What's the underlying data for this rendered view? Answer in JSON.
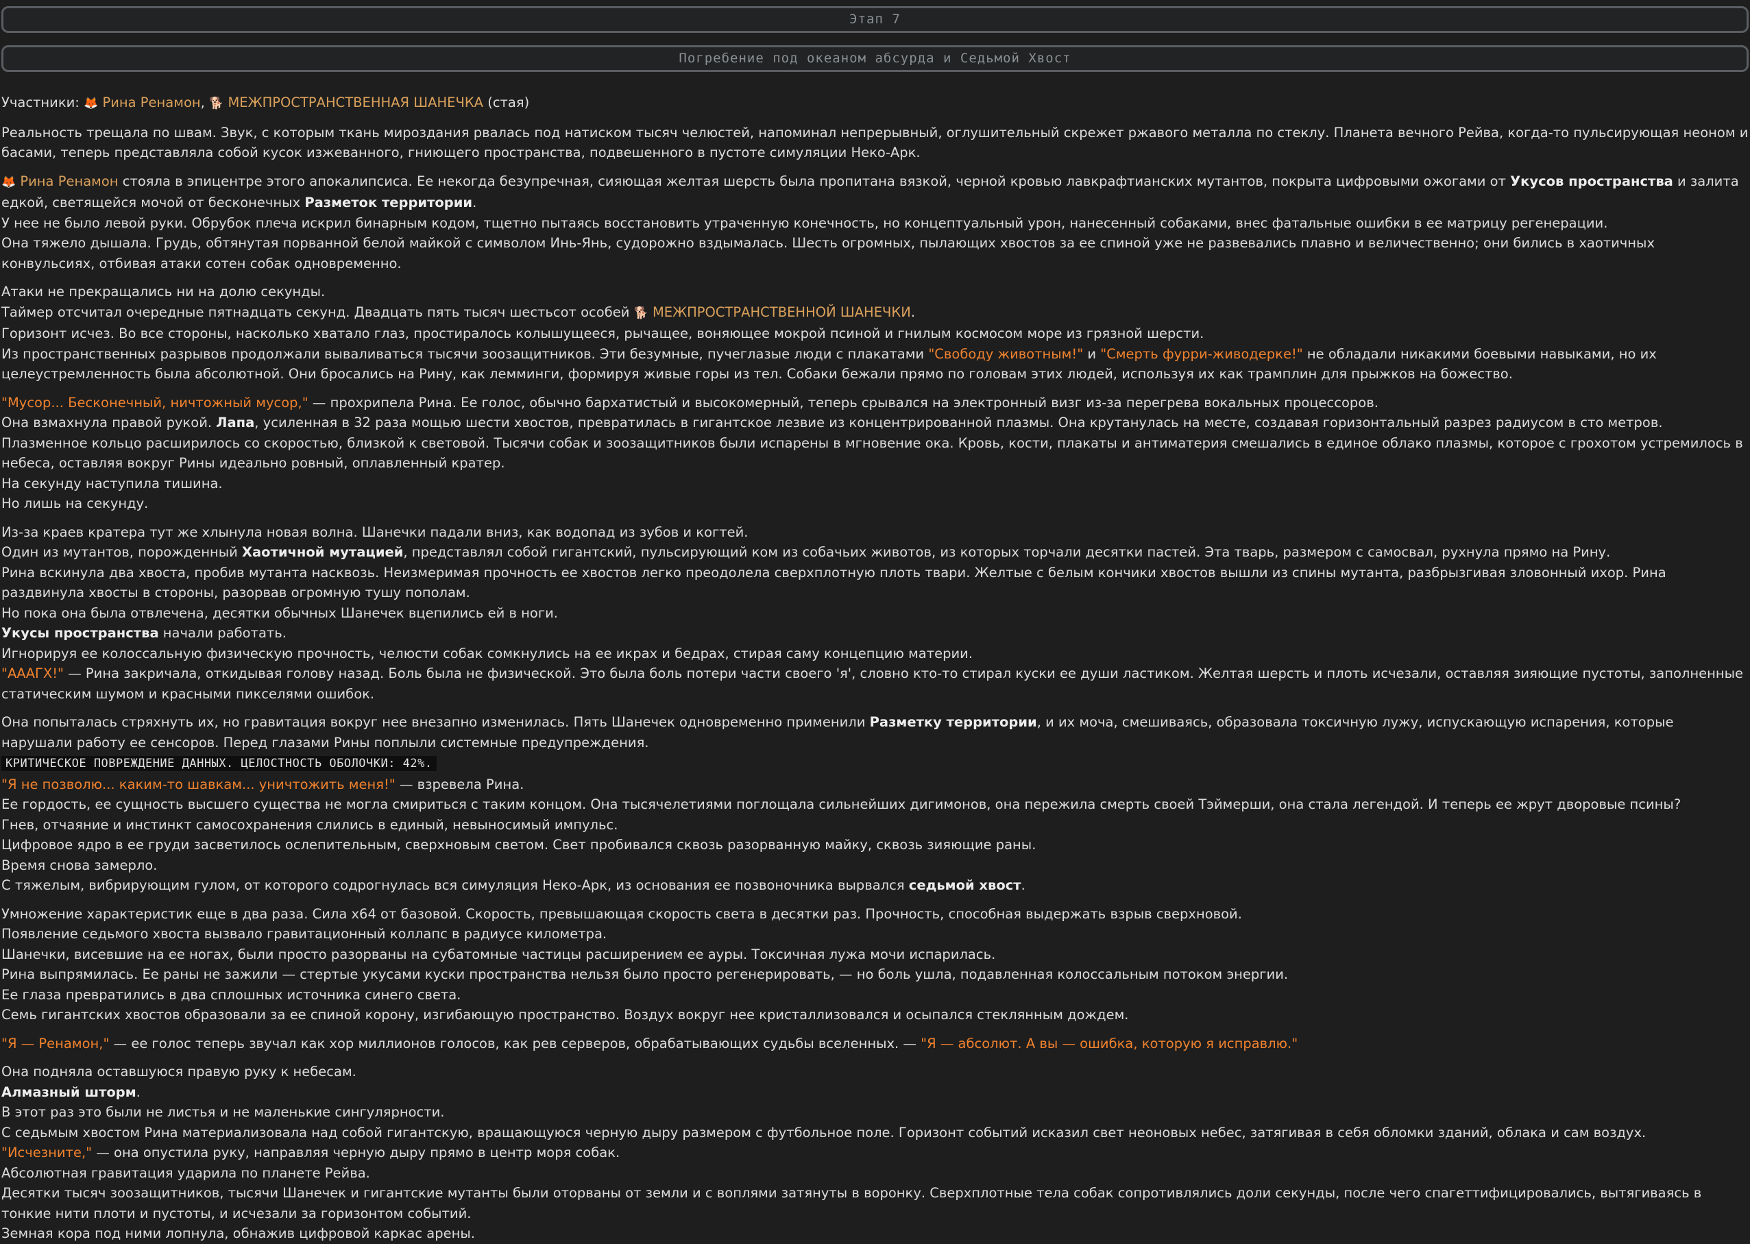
{
  "stage_label": "Этап 7",
  "chapter_title": "Погребение под океаном абсурда и Седьмой Хвост",
  "participants": {
    "label": "Участники:",
    "p1": "Рина Ренамон",
    "p2": "МЕЖПРОСТРАНСТВЕННАЯ ШАНЕЧКА",
    "suffix": "(стая)"
  },
  "fox_emoji": "🦊",
  "dog_emoji": "🐕",
  "paragraphs": [
    "Реальность трещала по швам. Звук, с которым ткань мироздания рвалась под натиском тысяч челюстей, напоминал непрерывный, оглушительный скрежет ржавого металла по стеклу. Планета вечного Рейва, когда-то пульсирующая неоном и басами, теперь представляла собой кусок изжеванного, гниющего пространства, подвешенного в пустоте симуляции Неко-Арк."
  ],
  "s2": {
    "name": "Рина Ренамон",
    "t1": " стояла в эпицентре этого апокалипсиса. Ее некогда безупречная, сияющая желтая шерсть была пропитана вязкой, черной кровью лавкрафтианских мутантов, покрыта цифровыми ожогами от ",
    "b1": "Укусов пространства",
    "t2": " и залита едкой, светящейся мочой от бесконечных ",
    "b2": "Разметок территории",
    "t3": ".",
    "l2": "У нее не было левой руки. Обрубок плеча искрил бинарным кодом, тщетно пытаясь восстановить утраченную конечность, но концептуальный урон, нанесенный собаками, внес фатальные ошибки в ее матрицу регенерации.",
    "l3": "Она тяжело дышала. Грудь, обтянутая порванной белой майкой с символом Инь-Янь, судорожно вздымалась. Шесть огромных, пылающих хвостов за ее спиной уже не развевались плавно и величественно; они бились в хаотичных конвульсиях, отбивая атаки сотен собак одновременно."
  },
  "s3": {
    "l1": "Атаки не прекращались ни на долю секунды.",
    "l2a": "Таймер отсчитал очередные пятнадцать секунд. Двадцать пять тысяч шестьсот особей ",
    "l2name": "МЕЖПРОСТРАНСТВЕННОЙ ШАНЕЧКИ",
    "l2b": ".",
    "l3": "Горизонт исчез. Во все стороны, насколько хватало глаз, простиралось колышущееся, рычащее, воняющее мокрой псиной и гнилым космосом море из грязной шерсти.",
    "l4a": "Из пространственных разрывов продолжали вываливаться тысячи зоозащитников. Эти безумные, пучеглазые люди с плакатами ",
    "l4q1": "\"Свободу животным!\"",
    "l4b": " и ",
    "l4q2": "\"Смерть фурри-живодерке!\"",
    "l4c": " не обладали никакими боевыми навыками, но их целеустремленность была абсолютной. Они бросались на Рину, как лемминги, формируя живые горы из тел. Собаки бежали прямо по головам этих людей, используя их как трамплин для прыжков на божество."
  },
  "s4": {
    "q": "\"Мусор... Бесконечный, ничтожный мусор,\"",
    "t": " — прохрипела Рина. Ее голос, обычно бархатистый и высокомерный, теперь срывался на электронный визг из-за перегрева вокальных процессоров.",
    "l2a": "Она взмахнула правой рукой. ",
    "l2b": "Лапа",
    "l2c": ", усиленная в 32 раза мощью шести хвостов, превратилась в гигантское лезвие из концентрированной плазмы. Она крутанулась на месте, создавая горизонтальный разрез радиусом в сто метров.",
    "l3": "Плазменное кольцо расширилось со скоростью, близкой к световой. Тысячи собак и зоозащитников были испарены в мгновение ока. Кровь, кости, плакаты и антиматерия смешались в единое облако плазмы, которое с грохотом устремилось в небеса, оставляя вокруг Рины идеально ровный, оплавленный кратер.",
    "l4": "На секунду наступила тишина.",
    "l5": "Но лишь на секунду."
  },
  "s5": {
    "l1": "Из-за краев кратера тут же хлынула новая волна. Шанечки падали вниз, как водопад из зубов и когтей.",
    "l2a": "Один из мутантов, порожденный ",
    "l2b": "Хаотичной мутацией",
    "l2c": ", представлял собой гигантский, пульсирующий ком из собачьих животов, из которых торчали десятки пастей. Эта тварь, размером с самосвал, рухнула прямо на Рину.",
    "l3": "Рина вскинула два хвоста, пробив мутанта насквозь. Неизмеримая прочность ее хвостов легко преодолела сверхплотную плоть твари. Желтые с белым кончики хвостов вышли из спины мутанта, разбрызгивая зловонный ихор. Рина раздвинула хвосты в стороны, разорвав огромную тушу пополам.",
    "l4": "Но пока она была отвлечена, десятки обычных Шанечек вцепились ей в ноги.",
    "l5a": "Укусы пространства",
    "l5b": " начали работать.",
    "l6": "Игнорируя ее колоссальную физическую прочность, челюсти собак сомкнулись на ее икрах и бедрах, стирая саму концепцию материи.",
    "l7q": "\"АААГХ!\"",
    "l7t": " — Рина закричала, откидывая голову назад. Боль была не физической. Это была боль потери части своего 'я', словно кто-то стирал куски ее души ластиком. Желтая шерсть и плоть исчезали, оставляя зияющие пустоты, заполненные статическим шумом и красными пикселями ошибок."
  },
  "s6": {
    "l1a": "Она попыталась стряхнуть их, но гравитация вокруг нее внезапно изменилась. Пять Шанечек одновременно применили ",
    "l1b": "Разметку территории",
    "l1c": ", и их моча, смешиваясь, образовала токсичную лужу, испускающую испарения, которые нарушали работу ее сенсоров. Перед глазами Рины поплыли системные предупреждения.",
    "code": "КРИТИЧЕСКОЕ ПОВРЕЖДЕНИЕ ДАННЫХ. ЦЕЛОСТНОСТЬ ОБОЛОЧКИ: 42%.",
    "l3q": "\"Я не позволю... каким-то шавкам... уничтожить меня!\"",
    "l3t": " — взревела Рина.",
    "l4": "Ее гордость, ее сущность высшего существа не могла смириться с таким концом. Она тысячелетиями поглощала сильнейших дигимонов, она пережила смерть своей Тэймерши, она стала легендой. И теперь ее жрут дворовые псины?",
    "l5": "Гнев, отчаяние и инстинкт самосохранения слились в единый, невыносимый импульс.",
    "l6": "Цифровое ядро в ее груди засветилось ослепительным, сверхновым светом. Свет пробивался сквозь разорванную майку, сквозь зияющие раны.",
    "l7": "Время снова замерло.",
    "l8a": "С тяжелым, вибрирующим гулом, от которого содрогнулась вся симуляция Неко-Арк, из основания ее позвоночника вырвался ",
    "l8b": "седьмой хвост",
    "l8c": "."
  },
  "s7": {
    "l1": "Умножение характеристик еще в два раза. Сила x64 от базовой. Скорость, превышающая скорость света в десятки раз. Прочность, способная выдержать взрыв сверхновой.",
    "l2": "Появление седьмого хвоста вызвало гравитационный коллапс в радиусе километра.",
    "l3": "Шанечки, висевшие на ее ногах, были просто разорваны на субатомные частицы расширением ее ауры. Токсичная лужа мочи испарилась.",
    "l4": "Рина выпрямилась. Ее раны не зажили — стертые укусами куски пространства нельзя было просто регенерировать, — но боль ушла, подавленная колоссальным потоком энергии.",
    "l5": "Ее глаза превратились в два сплошных источника синего света.",
    "l6": "Семь гигантских хвостов образовали за ее спиной корону, изгибающую пространство. Воздух вокруг нее кристаллизовался и осыпался стеклянным дождем."
  },
  "s8": {
    "q1": "\"Я — Ренамон,\"",
    "t": " — ее голос теперь звучал как хор миллионов голосов, как рев серверов, обрабатывающих судьбы вселенных. — ",
    "q2": "\"Я — абсолют. А вы — ошибка, которую я исправлю.\""
  },
  "s9": {
    "l1": "Она подняла оставшуюся правую руку к небесам.",
    "l2": "Алмазный шторм",
    "l2dot": ".",
    "l3": "В этот раз это были не листья и не маленькие сингулярности.",
    "l4": "С седьмым хвостом Рина материализовала над собой гигантскую, вращающуюся черную дыру размером с футбольное поле. Горизонт событий исказил свет неоновых небес, затягивая в себя обломки зданий, облака и сам воздух.",
    "l5q": "\"Исчезните,\"",
    "l5t": " — она опустила руку, направляя черную дыру прямо в центр моря собак.",
    "l6": "Абсолютная гравитация ударила по планете Рейва.",
    "l7": "Десятки тысяч зоозащитников, тысячи Шанечек и гигантские мутанты были оторваны от земли и с воплями затянуты в воронку. Сверхплотные тела собак сопротивлялись доли секунды, после чего спагеттифицировались, вытягиваясь в тонкие нити плоти и пустоты, и исчезали за горизонтом событий.",
    "l8": "Земная кора под ними лопнула, обнажив цифровой каркас арены."
  }
}
